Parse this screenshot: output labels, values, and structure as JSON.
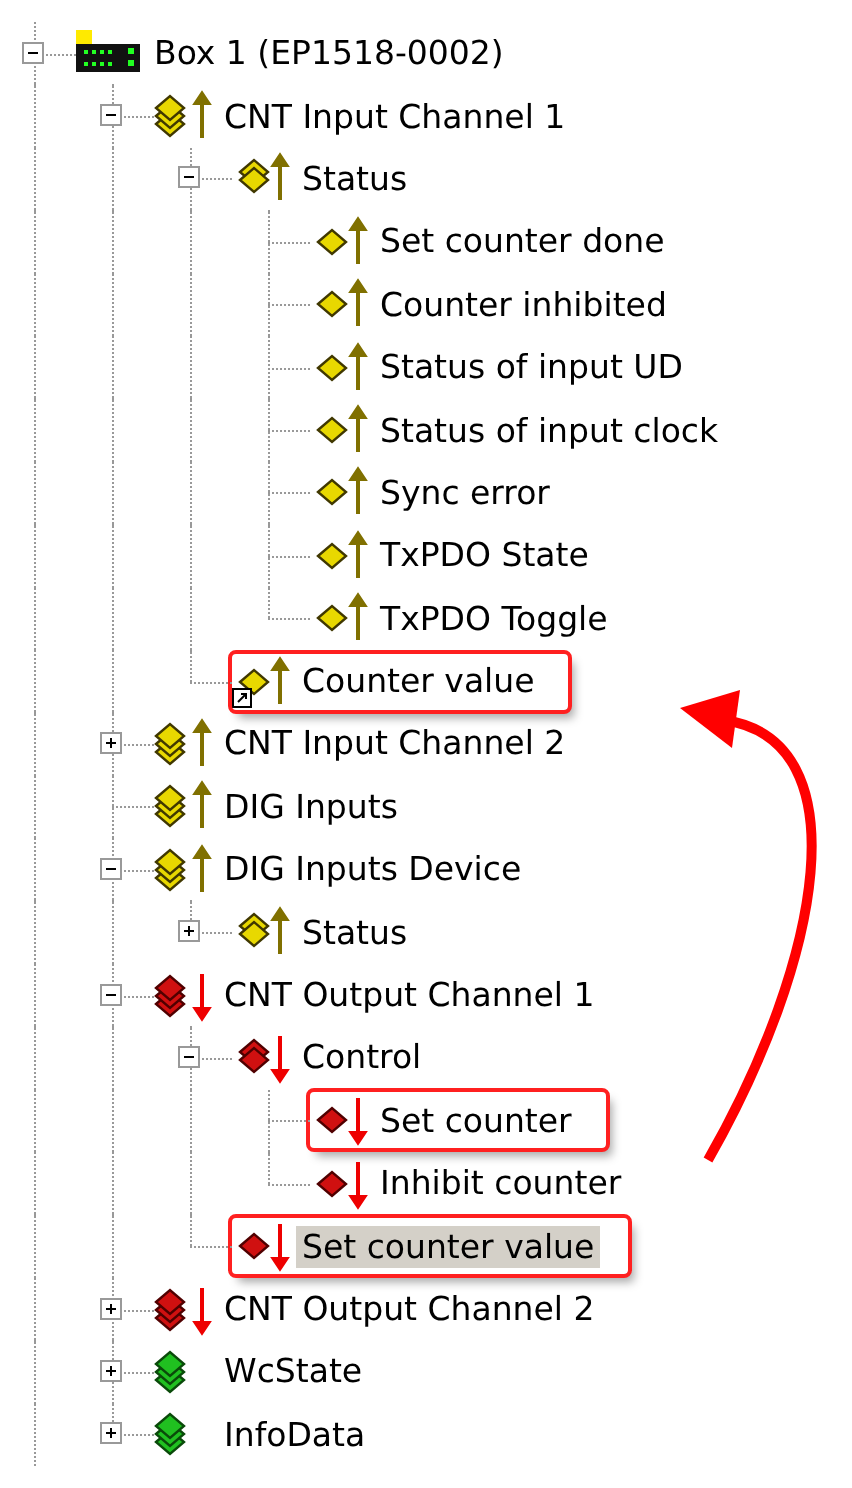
{
  "tree": [
    {
      "label": "Box 1 (EP1518-0002)",
      "kind": "device",
      "expanded": true,
      "selected": false,
      "highlighted": false,
      "linked": false,
      "children": [
        {
          "label": "CNT Input Channel 1",
          "kind": "input-group",
          "expanded": true,
          "selected": false,
          "highlighted": false,
          "linked": false,
          "children": [
            {
              "label": "Status",
              "kind": "input-status",
              "expanded": true,
              "selected": false,
              "highlighted": false,
              "linked": false,
              "children": [
                {
                  "label": "Set counter done",
                  "kind": "input-var",
                  "selected": false,
                  "highlighted": false,
                  "linked": false
                },
                {
                  "label": "Counter inhibited",
                  "kind": "input-var",
                  "selected": false,
                  "highlighted": false,
                  "linked": false
                },
                {
                  "label": "Status of input UD",
                  "kind": "input-var",
                  "selected": false,
                  "highlighted": false,
                  "linked": false
                },
                {
                  "label": "Status of input clock",
                  "kind": "input-var",
                  "selected": false,
                  "highlighted": false,
                  "linked": false
                },
                {
                  "label": "Sync error",
                  "kind": "input-var",
                  "selected": false,
                  "highlighted": false,
                  "linked": false
                },
                {
                  "label": "TxPDO State",
                  "kind": "input-var",
                  "selected": false,
                  "highlighted": false,
                  "linked": false
                },
                {
                  "label": "TxPDO Toggle",
                  "kind": "input-var",
                  "selected": false,
                  "highlighted": false,
                  "linked": false
                }
              ]
            },
            {
              "label": "Counter value",
              "kind": "input-var",
              "selected": false,
              "highlighted": true,
              "linked": true
            }
          ]
        },
        {
          "label": "CNT Input Channel 2",
          "kind": "input-group",
          "expanded": false,
          "selected": false,
          "highlighted": false,
          "linked": false
        },
        {
          "label": "DIG Inputs",
          "kind": "input-group",
          "selected": false,
          "highlighted": false,
          "linked": false
        },
        {
          "label": "DIG Inputs Device",
          "kind": "input-group",
          "expanded": true,
          "selected": false,
          "highlighted": false,
          "linked": false,
          "children": [
            {
              "label": "Status",
              "kind": "input-status",
              "expanded": false,
              "selected": false,
              "highlighted": false,
              "linked": false
            }
          ]
        },
        {
          "label": "CNT Output Channel 1",
          "kind": "output-group",
          "expanded": true,
          "selected": false,
          "highlighted": false,
          "linked": false,
          "children": [
            {
              "label": "Control",
              "kind": "output-status",
              "expanded": true,
              "selected": false,
              "highlighted": false,
              "linked": false,
              "children": [
                {
                  "label": "Set counter",
                  "kind": "output-var",
                  "selected": false,
                  "highlighted": true,
                  "linked": false
                },
                {
                  "label": "Inhibit counter",
                  "kind": "output-var",
                  "selected": false,
                  "highlighted": false,
                  "linked": false
                }
              ]
            },
            {
              "label": "Set counter value",
              "kind": "output-var",
              "selected": true,
              "highlighted": true,
              "linked": false
            }
          ]
        },
        {
          "label": "CNT Output Channel 2",
          "kind": "output-group",
          "expanded": false,
          "selected": false,
          "highlighted": false,
          "linked": false
        },
        {
          "label": "WcState",
          "kind": "plain-group",
          "expanded": false,
          "selected": false,
          "highlighted": false,
          "linked": false
        },
        {
          "label": "InfoData",
          "kind": "plain-group",
          "expanded": false,
          "selected": false,
          "highlighted": false,
          "linked": false
        }
      ]
    }
  ]
}
